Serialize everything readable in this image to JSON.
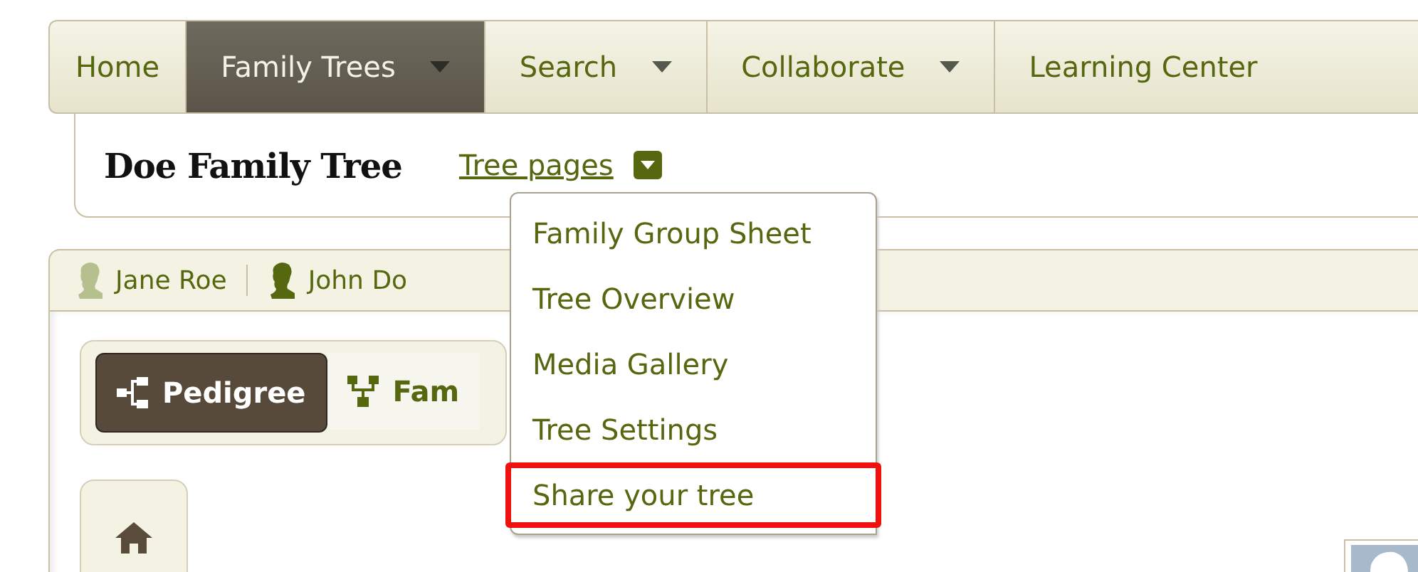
{
  "nav": {
    "tabs": [
      {
        "label": "Home",
        "selected": false,
        "dropdown": false
      },
      {
        "label": "Family Trees",
        "selected": true,
        "dropdown": true
      },
      {
        "label": "Search",
        "selected": false,
        "dropdown": true
      },
      {
        "label": "Collaborate",
        "selected": false,
        "dropdown": true
      },
      {
        "label": "Learning Center",
        "selected": false,
        "dropdown": false
      }
    ]
  },
  "tree_header": {
    "title": "Doe Family Tree",
    "menu_link": "Tree pages"
  },
  "tree_pages_menu": {
    "items": [
      {
        "label": "Family Group Sheet",
        "highlighted": false
      },
      {
        "label": "Tree Overview",
        "highlighted": false
      },
      {
        "label": "Media Gallery",
        "highlighted": false
      },
      {
        "label": "Tree Settings",
        "highlighted": false
      },
      {
        "label": "Share your tree",
        "highlighted": true
      }
    ]
  },
  "people": [
    {
      "name": "Jane Roe",
      "selected": false
    },
    {
      "name": "John Do",
      "selected": true
    }
  ],
  "view_toggle": [
    {
      "label": "Pedigree",
      "kind": "pedigree",
      "selected": true
    },
    {
      "label": "Fam",
      "kind": "family",
      "selected": false
    }
  ]
}
